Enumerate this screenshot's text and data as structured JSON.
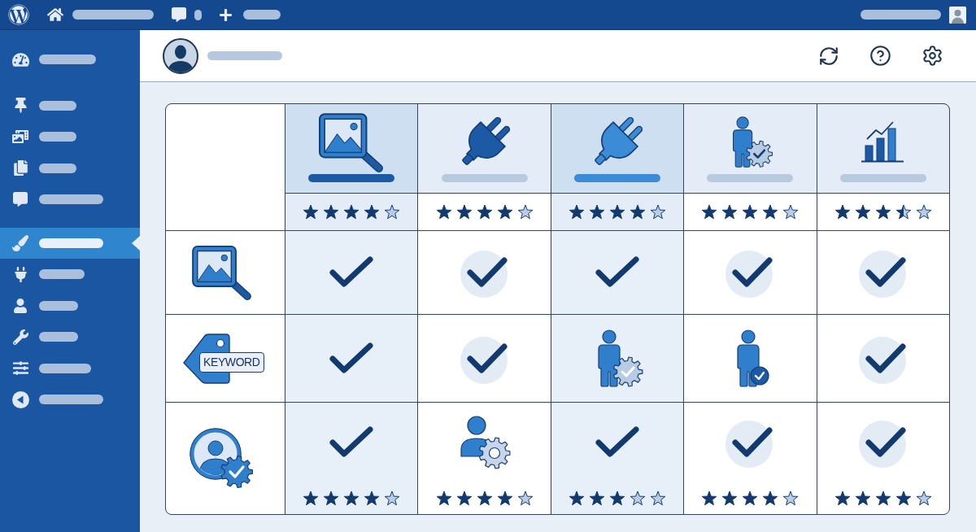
{
  "sidebar": {
    "items": [
      {
        "selected": false
      },
      {
        "selected": false
      },
      {
        "selected": false
      },
      {
        "selected": false
      },
      {
        "selected": false
      },
      {
        "selected": true
      },
      {
        "selected": false
      },
      {
        "selected": false
      },
      {
        "selected": false
      },
      {
        "selected": false
      },
      {
        "selected": false
      }
    ]
  },
  "comparison_table": {
    "columns": [
      {
        "highlighted": true,
        "color": "#1d5aa6",
        "stars": 4
      },
      {
        "highlighted": false,
        "color": "#b9c9de",
        "stars": 4
      },
      {
        "highlighted": true,
        "color": "#3b8bd6",
        "stars": 4
      },
      {
        "highlighted": false,
        "color": "#b9c9de",
        "stars": 4
      },
      {
        "highlighted": false,
        "color": "#b9c9de",
        "stars": 3.5
      }
    ],
    "rows": [
      {
        "cells": [
          {
            "kind": "check"
          },
          {
            "kind": "check"
          },
          {
            "kind": "check"
          },
          {
            "kind": "check"
          },
          {
            "kind": "check"
          }
        ]
      },
      {
        "tag": "KEYWORD",
        "cells": [
          {
            "kind": "check"
          },
          {
            "kind": "check"
          },
          {
            "kind": "user-gear-check"
          },
          {
            "kind": "user-check"
          },
          {
            "kind": "check"
          }
        ]
      },
      {
        "cells": [
          {
            "kind": "check",
            "stars": 4
          },
          {
            "kind": "user-gear",
            "stars": 4
          },
          {
            "kind": "check",
            "stars": 3
          },
          {
            "kind": "check",
            "stars": 4
          },
          {
            "kind": "check",
            "stars": 4
          }
        ]
      }
    ]
  }
}
